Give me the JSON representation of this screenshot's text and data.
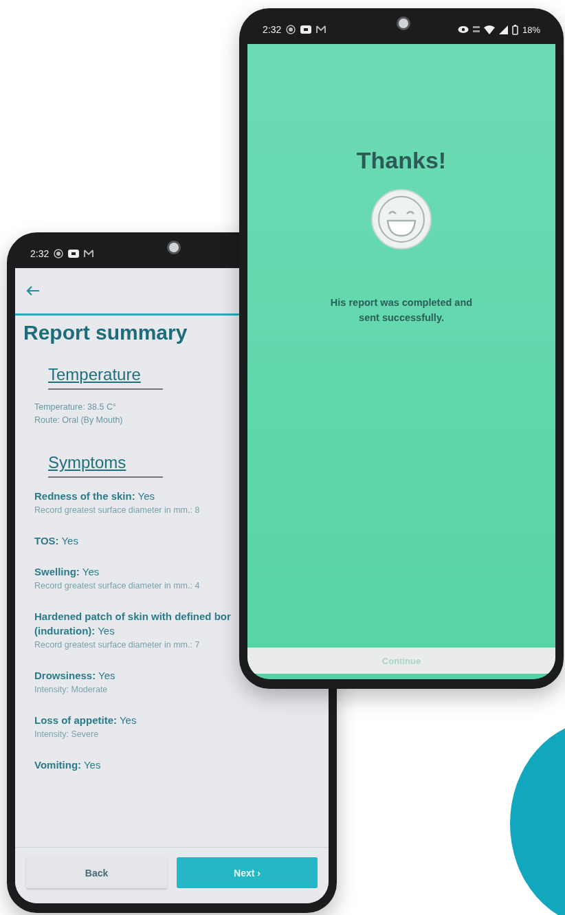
{
  "back_phone": {
    "status_bar": {
      "time": "2:32"
    },
    "screen": {
      "title": "Report summary",
      "sections": [
        {
          "kind": "plain",
          "title": "Temperature",
          "lines": [
            "Temperature: 38.5 C°",
            "Route: Oral (By Mouth)"
          ]
        },
        {
          "kind": "answers",
          "title": "Symptoms",
          "items": [
            {
              "label": "Redness of the skin:",
              "value": "Yes",
              "detail": "Record greatest surface diameter in mm.: 8"
            },
            {
              "label": "TOS:",
              "value": "Yes"
            },
            {
              "label": "Swelling:",
              "value": "Yes",
              "detail": "Record greatest surface diameter in mm.: 4"
            },
            {
              "label": "Hardened patch of skin with defined bor\n(induration):",
              "value": "Yes",
              "detail": "Record greatest surface diameter in mm.: 7"
            },
            {
              "label": "Drowsiness:",
              "value": "Yes",
              "detail": "Intensity: Moderate"
            },
            {
              "label": "Loss of appetite:",
              "value": "Yes",
              "detail": "Intensity: Severe"
            },
            {
              "label": "Vomiting:",
              "value": "Yes"
            }
          ]
        }
      ]
    },
    "buttons": [
      {
        "kind": "secondary",
        "label": "Back"
      },
      {
        "kind": "primary",
        "label": "Next ›"
      }
    ]
  },
  "front_phone": {
    "status_bar": {
      "time": "2:32",
      "battery": "18%"
    },
    "screen": {
      "title": "Thanks!",
      "message": "His report was completed and\nsent successfully.",
      "button": {
        "label": "Continue",
        "disabled": true
      }
    }
  }
}
